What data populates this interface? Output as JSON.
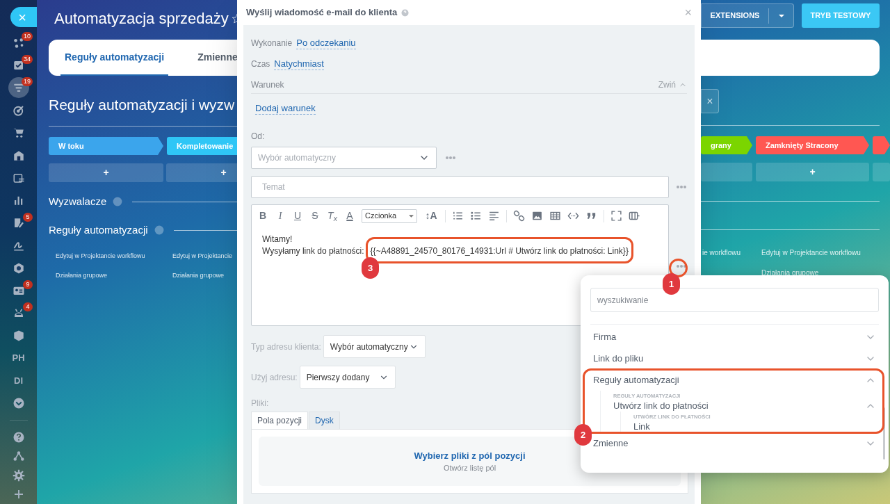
{
  "sidebar": {
    "close": "×",
    "items": [
      {
        "kind": "icon",
        "badge": "10",
        "selected": false
      },
      {
        "kind": "icon",
        "badge": "34",
        "selected": false
      },
      {
        "kind": "icon",
        "badge": "19",
        "selected": true
      },
      {
        "kind": "icon",
        "selected": false
      },
      {
        "kind": "icon",
        "selected": false
      },
      {
        "kind": "icon",
        "selected": false
      },
      {
        "kind": "icon",
        "selected": false
      },
      {
        "kind": "icon",
        "selected": false
      },
      {
        "kind": "icon",
        "badge": "5",
        "selected": false
      },
      {
        "kind": "icon",
        "selected": false
      },
      {
        "kind": "icon",
        "selected": false
      },
      {
        "kind": "icon",
        "badge": "9",
        "selected": false
      },
      {
        "kind": "icon",
        "badge": "4",
        "selected": false
      },
      {
        "kind": "icon",
        "selected": false
      },
      {
        "kind": "text",
        "text": "PH",
        "selected": false
      },
      {
        "kind": "text",
        "text": "DI",
        "selected": false
      },
      {
        "kind": "icon",
        "selected": false
      }
    ],
    "bottom_items": [
      {
        "kind": "icon",
        "selected": false
      },
      {
        "kind": "icon",
        "selected": false
      },
      {
        "kind": "icon",
        "selected": false
      },
      {
        "kind": "icon",
        "selected": false
      }
    ]
  },
  "page_title": "Automatyzacja sprzedaży",
  "header_buttons": [
    {
      "kind": "split",
      "label": "EXTENSIONS"
    },
    {
      "kind": "primary",
      "label": "TRYB TESTOWY"
    }
  ],
  "tabs": [
    {
      "label": "Reguły automatyzacji",
      "selected": true
    },
    {
      "label": "Zmienne",
      "selected": false
    }
  ],
  "clear_button": "×",
  "heading": "Reguły automatyzacji i wyzw",
  "stages_left": [
    {
      "label": "W toku",
      "color": "#3ba5ec",
      "add": "+"
    },
    {
      "label": "Kompletowanie",
      "color": "#2fc6f6",
      "add": "+"
    }
  ],
  "stages_right": [
    {
      "label": "grany",
      "color": "#7bd500"
    },
    {
      "label": "Zamknięty Stracony",
      "color": "#ff5752",
      "add": "+"
    },
    {
      "color": "#ff5752"
    }
  ],
  "sections": [
    {
      "title": "Wyzwalacze"
    },
    {
      "title": "Reguły automatyzacji"
    }
  ],
  "columns_left": [
    {
      "edit": "Edytuj w Projektancie workflowu",
      "group": "Działania grupowe"
    },
    {
      "edit": "Edytuj w Projektancie",
      "group": "Działania grupowe"
    }
  ],
  "columns_right": [
    {
      "edit": "ie workflowu"
    },
    {
      "edit": "Edytuj w Projektancie workflowu",
      "group": "Działania grupowe"
    }
  ],
  "dialog": {
    "title": "Wyślij wiadomość e-mail do klienta",
    "close": "×",
    "fields": [
      {
        "label": "Wykonanie",
        "value": "Po odczekaniu"
      },
      {
        "label": "Czas",
        "value": "Natychmiast"
      }
    ],
    "condition": {
      "label": "Warunek",
      "toggle": "Zwiń",
      "expanded": true,
      "add": "Dodaj warunek"
    },
    "from": {
      "label": "Od:",
      "placeholder": "Wybór automatyczny"
    },
    "subject": {
      "placeholder": "Temat"
    },
    "editor": {
      "toolbar": [
        {
          "kind": "bold",
          "text": "B"
        },
        {
          "kind": "italic",
          "text": "I"
        },
        {
          "kind": "underline",
          "text": "U"
        },
        {
          "kind": "strike",
          "text": "S"
        },
        {
          "kind": "clear",
          "text": "T$_{x}$"
        },
        {
          "kind": "color",
          "text": "A"
        },
        {
          "kind": "select",
          "text": "Czcionka"
        },
        {
          "kind": "size",
          "text": "↕A"
        },
        {
          "kind": "separator"
        },
        {
          "kind": "ordered-list"
        },
        {
          "kind": "bullet-list"
        },
        {
          "kind": "align"
        },
        {
          "kind": "separator"
        },
        {
          "kind": "link"
        },
        {
          "kind": "image"
        },
        {
          "kind": "table"
        },
        {
          "kind": "code"
        },
        {
          "kind": "quote"
        },
        {
          "kind": "separator"
        },
        {
          "kind": "fullscreen"
        },
        {
          "kind": "source"
        }
      ],
      "lines": [
        {
          "text": "Witamy!"
        },
        {
          "text": "Wysyłamy link do płatności:",
          "variable": "{{~A48891_24570_80176_14931:Url # Utwórz link do płatności: Link}}"
        }
      ]
    },
    "address_type": {
      "label": "Typ adresu klienta:",
      "value": "Wybór automatyczny"
    },
    "use_address": {
      "label": "Użyj adresu:",
      "value": "Pierwszy dodany"
    },
    "files": {
      "label": "Pliki:",
      "tabs": [
        {
          "label": "Pola pozycji",
          "selected": true
        },
        {
          "label": "Dysk",
          "selected": false
        }
      ],
      "link": "Wybierz pliki z pól pozycji",
      "hint": "Otwórz listę pól"
    }
  },
  "popup": {
    "placeholder": "wyszukiwanie",
    "items": [
      {
        "label": "Firma",
        "expanded": false
      },
      {
        "label": "Link do pliku",
        "expanded": false
      },
      {
        "label": "Reguły automatyzacji",
        "expanded": true,
        "children": [
          {
            "caption": "REGUŁY AUTOMATYZACJI",
            "label": "Utwórz link do płatności",
            "expanded": true,
            "children": [
              {
                "caption": "UTWÓRZ LINK DO PŁATNOŚCI",
                "label": "Link"
              }
            ]
          }
        ]
      },
      {
        "label": "Zmienne",
        "expanded": false
      }
    ]
  },
  "annotations": [
    {
      "number": "1"
    },
    {
      "number": "2"
    },
    {
      "number": "3"
    }
  ]
}
